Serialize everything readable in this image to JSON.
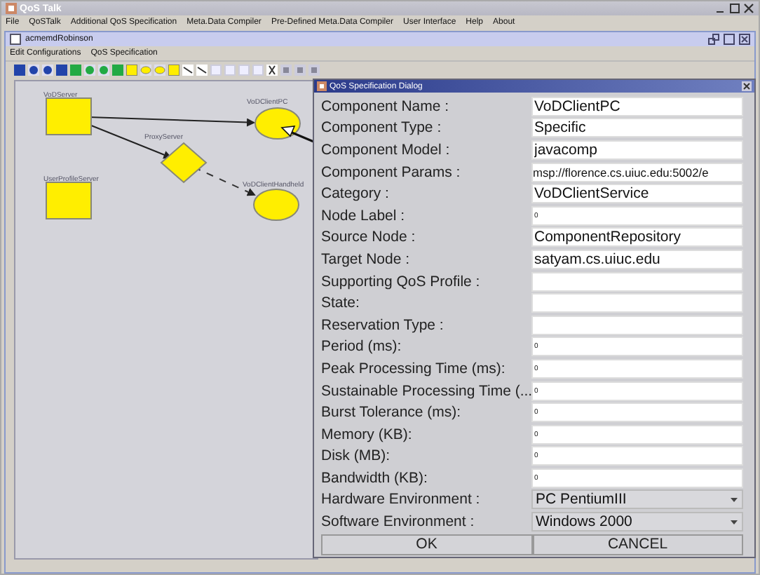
{
  "window": {
    "title": "QoS Talk"
  },
  "menu": [
    "File",
    "QoSTalk",
    "Additional QoS Specification",
    "Meta.Data Compiler",
    "Pre-Defined Meta.Data Compiler",
    "User Interface",
    "Help",
    "About"
  ],
  "frame": {
    "title": "acmemdRobinson",
    "menu": [
      "Edit Configurations",
      "QoS Specification"
    ]
  },
  "nodes": [
    {
      "kind": "rect",
      "label": "VoDServer"
    },
    {
      "kind": "diamond",
      "label": "ProxyServer"
    },
    {
      "kind": "ellipse",
      "label": "VoDClientPC"
    },
    {
      "kind": "rect",
      "label": "UserProfileServer"
    },
    {
      "kind": "ellipse",
      "label": "VoDClientHandheld"
    }
  ],
  "dialog": {
    "title": "QoS Specification Dialog",
    "fields": [
      {
        "kind": "text",
        "label": "Component Name :",
        "value": "VoDClientPC"
      },
      {
        "kind": "text",
        "label": "Component Type :",
        "value": "Specific"
      },
      {
        "kind": "text",
        "label": "Component Model :",
        "value": "javacomp"
      },
      {
        "kind": "text",
        "label": "Component Params :",
        "value": "msp://florence.cs.uiuc.edu:5002/e"
      },
      {
        "kind": "text",
        "label": "Category :",
        "value": "VoDClientService"
      },
      {
        "kind": "text",
        "label": "Node Label :",
        "value": "0"
      },
      {
        "kind": "text",
        "label": "Source Node :",
        "value": "ComponentRepository"
      },
      {
        "kind": "text",
        "label": "Target Node :",
        "value": "satyam.cs.uiuc.edu"
      },
      {
        "kind": "text",
        "label": "Supporting QoS Profile :"
      },
      {
        "kind": "text",
        "label": "State:"
      },
      {
        "kind": "text",
        "label": "Reservation Type :"
      },
      {
        "kind": "text",
        "label": "Period (ms):",
        "value": "0"
      },
      {
        "kind": "text",
        "label": "Peak Processing Time (ms):",
        "value": "0"
      },
      {
        "kind": "text",
        "label": "Sustainable Processing Time (...",
        "value": "0"
      },
      {
        "kind": "text",
        "label": "Burst Tolerance (ms):",
        "value": "0"
      },
      {
        "kind": "text",
        "label": "Memory (KB):",
        "value": "0"
      },
      {
        "kind": "text",
        "label": "Disk (MB):",
        "value": "0"
      },
      {
        "kind": "text",
        "label": "Bandwidth (KB):",
        "value": "0"
      },
      {
        "kind": "dropdown",
        "label": "Hardware Environment :",
        "value": "PC PentiumIII"
      },
      {
        "kind": "dropdown",
        "label": "Software Environment :",
        "value": "Windows 2000"
      }
    ],
    "buttons": [
      "OK",
      "CANCEL"
    ]
  }
}
